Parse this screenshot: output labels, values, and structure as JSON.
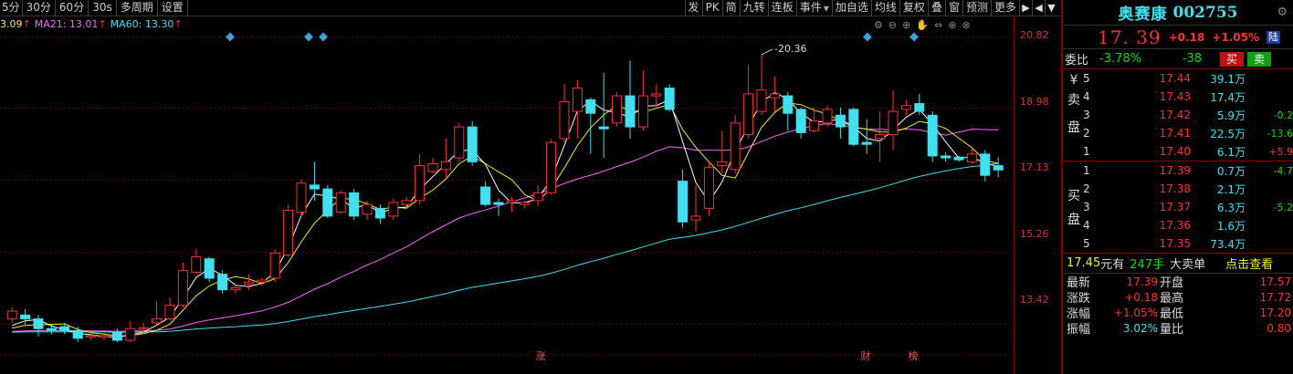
{
  "toolbar": {
    "periods": [
      "5分",
      "30分",
      "60分",
      "30s",
      "多周期",
      "设置"
    ],
    "actions": [
      "发",
      "PK",
      "简",
      "九转",
      "连板",
      "事件",
      "加自选",
      "均线",
      "复权",
      "叠",
      "窗",
      "预测",
      "更多"
    ],
    "icon_names": [
      "export-icon",
      "left-arrow-icon",
      "dropdown-icon"
    ]
  },
  "ma_legend": {
    "ma5": "3.09",
    "ma5_arrow": "↑",
    "ma21_label": "MA21: 13.01",
    "ma21_arrow": "↑",
    "ma60_label": "MA60: 13.30",
    "ma60_arrow": "↑"
  },
  "chart_tools": [
    "settings-icon",
    "zoom-out-icon",
    "zoom-in-icon",
    "hand-icon",
    "expand-icon",
    "plus-icon",
    "close-icon"
  ],
  "chart_data": {
    "type": "candlestick",
    "ylim": [
      12.6,
      21.3
    ],
    "y_ticks": [
      "20.82",
      "18.98",
      "17.13",
      "15.26",
      "13.42"
    ],
    "max_label": "20.36",
    "bottom_markers": [
      "涨",
      "财",
      "榜"
    ],
    "candles": [
      {
        "o": 13.55,
        "c": 13.75,
        "h": 13.85,
        "l": 13.45
      },
      {
        "o": 13.65,
        "c": 13.55,
        "h": 13.8,
        "l": 13.4
      },
      {
        "o": 13.55,
        "c": 13.3,
        "h": 13.65,
        "l": 13.1
      },
      {
        "o": 13.3,
        "c": 13.25,
        "h": 13.4,
        "l": 13.15
      },
      {
        "o": 13.35,
        "c": 13.25,
        "h": 13.45,
        "l": 13.15
      },
      {
        "o": 13.25,
        "c": 13.05,
        "h": 13.35,
        "l": 12.95
      },
      {
        "o": 13.1,
        "c": 13.12,
        "h": 13.2,
        "l": 13.0
      },
      {
        "o": 13.1,
        "c": 13.12,
        "h": 13.2,
        "l": 13.0
      },
      {
        "o": 13.2,
        "c": 13.0,
        "h": 13.3,
        "l": 12.95
      },
      {
        "o": 13.0,
        "c": 13.3,
        "h": 13.5,
        "l": 12.95
      },
      {
        "o": 13.3,
        "c": 13.32,
        "h": 13.45,
        "l": 13.2
      },
      {
        "o": 13.45,
        "c": 13.55,
        "h": 14.0,
        "l": 13.4
      },
      {
        "o": 13.55,
        "c": 13.9,
        "h": 14.1,
        "l": 13.5
      },
      {
        "o": 13.9,
        "c": 14.8,
        "h": 15.0,
        "l": 13.85
      },
      {
        "o": 14.75,
        "c": 15.15,
        "h": 15.35,
        "l": 14.7
      },
      {
        "o": 15.1,
        "c": 14.6,
        "h": 15.15,
        "l": 14.5
      },
      {
        "o": 14.7,
        "c": 14.3,
        "h": 14.8,
        "l": 14.2
      },
      {
        "o": 14.3,
        "c": 14.35,
        "h": 14.4,
        "l": 14.2
      },
      {
        "o": 14.45,
        "c": 14.5,
        "h": 14.7,
        "l": 14.3
      },
      {
        "o": 14.5,
        "c": 14.55,
        "h": 14.6,
        "l": 14.4
      },
      {
        "o": 14.6,
        "c": 15.25,
        "h": 15.35,
        "l": 14.5
      },
      {
        "o": 15.2,
        "c": 16.35,
        "h": 16.5,
        "l": 15.15
      },
      {
        "o": 16.3,
        "c": 17.05,
        "h": 17.15,
        "l": 16.2
      },
      {
        "o": 17.0,
        "c": 16.9,
        "h": 17.6,
        "l": 16.6
      },
      {
        "o": 16.9,
        "c": 16.2,
        "h": 17.0,
        "l": 16.15
      },
      {
        "o": 16.3,
        "c": 16.8,
        "h": 16.85,
        "l": 16.25
      },
      {
        "o": 16.8,
        "c": 16.2,
        "h": 16.9,
        "l": 16.1
      },
      {
        "o": 16.25,
        "c": 16.5,
        "h": 16.6,
        "l": 16.1
      },
      {
        "o": 16.4,
        "c": 16.15,
        "h": 16.5,
        "l": 16.0
      },
      {
        "o": 16.2,
        "c": 16.55,
        "h": 16.65,
        "l": 16.1
      },
      {
        "o": 16.5,
        "c": 16.6,
        "h": 16.7,
        "l": 16.4
      },
      {
        "o": 16.6,
        "c": 17.5,
        "h": 17.8,
        "l": 16.5
      },
      {
        "o": 17.35,
        "c": 17.55,
        "h": 17.7,
        "l": 17.3
      },
      {
        "o": 17.4,
        "c": 17.6,
        "h": 18.2,
        "l": 17.2
      },
      {
        "o": 17.7,
        "c": 18.5,
        "h": 18.6,
        "l": 17.6
      },
      {
        "o": 18.5,
        "c": 17.6,
        "h": 18.65,
        "l": 17.5
      },
      {
        "o": 16.95,
        "c": 16.5,
        "h": 17.1,
        "l": 16.45
      },
      {
        "o": 16.55,
        "c": 16.5,
        "h": 16.65,
        "l": 16.2
      },
      {
        "o": 16.55,
        "c": 16.6,
        "h": 16.7,
        "l": 16.3
      },
      {
        "o": 16.5,
        "c": 16.55,
        "h": 16.6,
        "l": 16.4
      },
      {
        "o": 16.6,
        "c": 16.8,
        "h": 17.0,
        "l": 16.45
      },
      {
        "o": 16.8,
        "c": 18.1,
        "h": 18.2,
        "l": 16.75
      },
      {
        "o": 18.2,
        "c": 19.15,
        "h": 19.6,
        "l": 18.1
      },
      {
        "o": 18.9,
        "c": 19.5,
        "h": 19.7,
        "l": 18.2
      },
      {
        "o": 19.2,
        "c": 18.85,
        "h": 19.25,
        "l": 17.8
      },
      {
        "o": 18.5,
        "c": 18.45,
        "h": 19.9,
        "l": 17.7
      },
      {
        "o": 18.6,
        "c": 19.3,
        "h": 19.4,
        "l": 18.5
      },
      {
        "o": 19.3,
        "c": 18.5,
        "h": 20.2,
        "l": 18.2
      },
      {
        "o": 18.5,
        "c": 19.3,
        "h": 19.95,
        "l": 18.4
      },
      {
        "o": 19.3,
        "c": 19.35,
        "h": 19.6,
        "l": 19.0
      },
      {
        "o": 19.5,
        "c": 18.95,
        "h": 19.6,
        "l": 18.9
      },
      {
        "o": 17.1,
        "c": 16.05,
        "h": 17.4,
        "l": 15.9
      },
      {
        "o": 16.1,
        "c": 16.2,
        "h": 17.0,
        "l": 15.8
      },
      {
        "o": 16.4,
        "c": 17.45,
        "h": 17.6,
        "l": 16.2
      },
      {
        "o": 17.5,
        "c": 17.6,
        "h": 18.4,
        "l": 17.3
      },
      {
        "o": 17.4,
        "c": 18.6,
        "h": 18.8,
        "l": 17.3
      },
      {
        "o": 18.3,
        "c": 19.35,
        "h": 20.1,
        "l": 18.2
      },
      {
        "o": 18.9,
        "c": 19.45,
        "h": 20.36,
        "l": 18.8
      },
      {
        "o": 19.25,
        "c": 19.35,
        "h": 19.8,
        "l": 18.9
      },
      {
        "o": 19.3,
        "c": 18.85,
        "h": 19.4,
        "l": 18.4
      },
      {
        "o": 18.95,
        "c": 18.35,
        "h": 19.0,
        "l": 18.2
      },
      {
        "o": 18.4,
        "c": 18.65,
        "h": 19.0,
        "l": 18.35
      },
      {
        "o": 18.6,
        "c": 18.95,
        "h": 19.05,
        "l": 18.5
      },
      {
        "o": 18.8,
        "c": 18.5,
        "h": 19.0,
        "l": 18.2
      },
      {
        "o": 18.95,
        "c": 18.05,
        "h": 19.0,
        "l": 18.0
      },
      {
        "o": 18.1,
        "c": 18.05,
        "h": 18.7,
        "l": 17.8
      },
      {
        "o": 18.2,
        "c": 18.3,
        "h": 18.9,
        "l": 17.6
      },
      {
        "o": 18.3,
        "c": 18.9,
        "h": 19.45,
        "l": 17.9
      },
      {
        "o": 18.95,
        "c": 19.05,
        "h": 19.2,
        "l": 18.8
      },
      {
        "o": 19.1,
        "c": 18.9,
        "h": 19.35,
        "l": 18.8
      },
      {
        "o": 18.8,
        "c": 17.75,
        "h": 18.9,
        "l": 17.6
      },
      {
        "o": 17.75,
        "c": 17.7,
        "h": 17.85,
        "l": 17.6
      },
      {
        "o": 17.72,
        "c": 17.65,
        "h": 17.75,
        "l": 17.6
      },
      {
        "o": 17.6,
        "c": 17.8,
        "h": 17.95,
        "l": 17.55
      },
      {
        "o": 17.8,
        "c": 17.25,
        "h": 17.9,
        "l": 17.1
      },
      {
        "o": 17.5,
        "c": 17.39,
        "h": 17.72,
        "l": 17.2
      }
    ]
  },
  "stock": {
    "name": "奥赛康",
    "code": "002755",
    "price": "17. 39",
    "change": "+0.18",
    "change_pct": "+1.05%",
    "badge": "陆"
  },
  "weibi": {
    "label": "委比",
    "ratio": "-3.78%",
    "diff": "-38",
    "buy_label": "买",
    "sell_label": "卖"
  },
  "ask": {
    "side_label_1": "卖",
    "side_label_2": "盘",
    "currency": "¥",
    "rows": [
      {
        "level": "5",
        "price": "17.44",
        "vol": "39.1万",
        "delta": ""
      },
      {
        "level": "4",
        "price": "17.43",
        "vol": "17.4万",
        "delta": ""
      },
      {
        "level": "3",
        "price": "17.42",
        "vol": "5.9万",
        "delta": "-0.2"
      },
      {
        "level": "2",
        "price": "17.41",
        "vol": "22.5万",
        "delta": "-13.6"
      },
      {
        "level": "1",
        "price": "17.40",
        "vol": "6.1万",
        "delta": "+5.9"
      }
    ]
  },
  "bid": {
    "side_label_1": "买",
    "side_label_2": "盘",
    "rows": [
      {
        "level": "1",
        "price": "17.39",
        "vol": "0.7万",
        "delta": "-4.7"
      },
      {
        "level": "2",
        "price": "17.38",
        "vol": "2.1万",
        "delta": ""
      },
      {
        "level": "3",
        "price": "17.37",
        "vol": "6.3万",
        "delta": "-5.2"
      },
      {
        "level": "4",
        "price": "17.36",
        "vol": "1.6万",
        "delta": ""
      },
      {
        "level": "5",
        "price": "17.35",
        "vol": "73.4万",
        "delta": ""
      }
    ]
  },
  "tape": {
    "price": "17.45",
    "yuanyou": "元有",
    "hands": "247手",
    "big": "大卖单",
    "click": "点击查看"
  },
  "stats": [
    {
      "k1": "最新",
      "v1": "17.39",
      "k2": "开盘",
      "v2": "17.57"
    },
    {
      "k1": "涨跌",
      "v1": "+0.18",
      "k2": "最高",
      "v2": "17.72"
    },
    {
      "k1": "涨幅",
      "v1": "+1.05%",
      "k2": "最低",
      "v2": "17.20"
    },
    {
      "k1": "振幅",
      "v1": "3.02%",
      "k2": "量比",
      "v2": "0.80"
    }
  ],
  "colors": {
    "up": "#ff3030",
    "down": "#3fe0f0",
    "ma5": "#f2f21c",
    "ma21": "#ff66ff",
    "ma60": "#3fe0f0",
    "event_marker": "#3aa0e0"
  }
}
